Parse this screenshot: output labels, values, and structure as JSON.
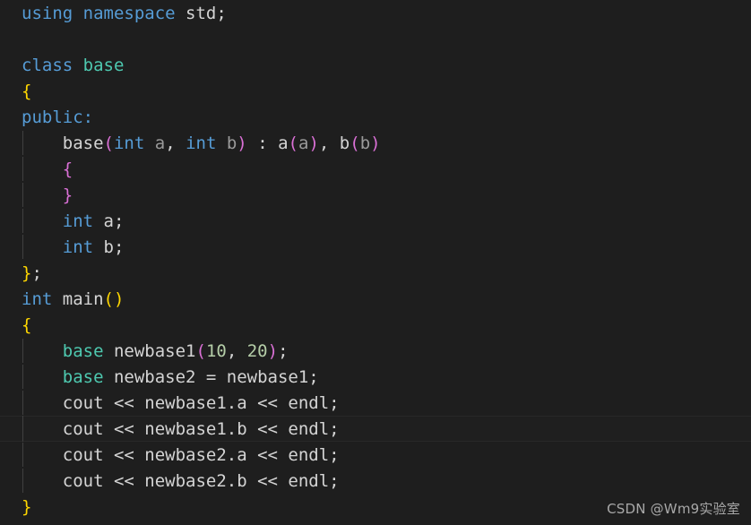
{
  "editor": {
    "language": "cpp",
    "background_color": "#1e1e1e",
    "foreground_color": "#d4d4d4",
    "current_line_index": 17,
    "palette": {
      "keyword": "#569cd6",
      "type": "#4ec9b0",
      "plain": "#d4d4d4",
      "number": "#b5cea8",
      "bracket_level1": "#ffd700",
      "bracket_level2": "#da70d6",
      "parameter": "#9a9a9a",
      "indent_guide": "#404040",
      "current_line_border": "#282828"
    },
    "lines": [
      {
        "indent_guide": false,
        "current": false,
        "tokens": [
          {
            "t": "using namespace ",
            "c": "kw"
          },
          {
            "t": "std;",
            "c": "plain"
          }
        ]
      },
      {
        "indent_guide": false,
        "current": false,
        "tokens": []
      },
      {
        "indent_guide": false,
        "current": false,
        "tokens": [
          {
            "t": "class ",
            "c": "kw"
          },
          {
            "t": "base",
            "c": "type"
          }
        ]
      },
      {
        "indent_guide": false,
        "current": false,
        "tokens": [
          {
            "t": "{",
            "c": "br1"
          }
        ]
      },
      {
        "indent_guide": false,
        "current": false,
        "tokens": [
          {
            "t": "public:",
            "c": "kw"
          }
        ]
      },
      {
        "indent_guide": true,
        "current": false,
        "tokens": [
          {
            "t": "    base",
            "c": "plain"
          },
          {
            "t": "(",
            "c": "br2"
          },
          {
            "t": "int ",
            "c": "kw"
          },
          {
            "t": "a",
            "c": "param"
          },
          {
            "t": ", ",
            "c": "plain"
          },
          {
            "t": "int ",
            "c": "kw"
          },
          {
            "t": "b",
            "c": "param"
          },
          {
            "t": ")",
            "c": "br2"
          },
          {
            "t": " : ",
            "c": "plain"
          },
          {
            "t": "a",
            "c": "plain"
          },
          {
            "t": "(",
            "c": "br2"
          },
          {
            "t": "a",
            "c": "param"
          },
          {
            "t": ")",
            "c": "br2"
          },
          {
            "t": ", ",
            "c": "plain"
          },
          {
            "t": "b",
            "c": "plain"
          },
          {
            "t": "(",
            "c": "br2"
          },
          {
            "t": "b",
            "c": "param"
          },
          {
            "t": ")",
            "c": "br2"
          }
        ]
      },
      {
        "indent_guide": true,
        "current": false,
        "tokens": [
          {
            "t": "    ",
            "c": "plain"
          },
          {
            "t": "{",
            "c": "br2"
          }
        ]
      },
      {
        "indent_guide": true,
        "current": false,
        "tokens": [
          {
            "t": "    ",
            "c": "plain"
          },
          {
            "t": "}",
            "c": "br2"
          }
        ]
      },
      {
        "indent_guide": true,
        "current": false,
        "tokens": [
          {
            "t": "    ",
            "c": "plain"
          },
          {
            "t": "int ",
            "c": "kw"
          },
          {
            "t": "a;",
            "c": "plain"
          }
        ]
      },
      {
        "indent_guide": true,
        "current": false,
        "tokens": [
          {
            "t": "    ",
            "c": "plain"
          },
          {
            "t": "int ",
            "c": "kw"
          },
          {
            "t": "b;",
            "c": "plain"
          }
        ]
      },
      {
        "indent_guide": false,
        "current": false,
        "tokens": [
          {
            "t": "}",
            "c": "br1"
          },
          {
            "t": ";",
            "c": "plain"
          }
        ]
      },
      {
        "indent_guide": false,
        "current": false,
        "tokens": [
          {
            "t": "int ",
            "c": "kw"
          },
          {
            "t": "main",
            "c": "plain"
          },
          {
            "t": "()",
            "c": "br1"
          }
        ]
      },
      {
        "indent_guide": false,
        "current": false,
        "tokens": [
          {
            "t": "{",
            "c": "br1"
          }
        ]
      },
      {
        "indent_guide": true,
        "current": false,
        "tokens": [
          {
            "t": "    ",
            "c": "plain"
          },
          {
            "t": "base",
            "c": "type"
          },
          {
            "t": " newbase1",
            "c": "plain"
          },
          {
            "t": "(",
            "c": "br2"
          },
          {
            "t": "10",
            "c": "num"
          },
          {
            "t": ", ",
            "c": "plain"
          },
          {
            "t": "20",
            "c": "num"
          },
          {
            "t": ")",
            "c": "br2"
          },
          {
            "t": ";",
            "c": "plain"
          }
        ]
      },
      {
        "indent_guide": true,
        "current": false,
        "tokens": [
          {
            "t": "    ",
            "c": "plain"
          },
          {
            "t": "base",
            "c": "type"
          },
          {
            "t": " newbase2 = newbase1;",
            "c": "plain"
          }
        ]
      },
      {
        "indent_guide": true,
        "current": false,
        "tokens": [
          {
            "t": "    cout << newbase1.a << endl;",
            "c": "plain"
          }
        ]
      },
      {
        "indent_guide": true,
        "current": true,
        "tokens": [
          {
            "t": "    cout << newbase1.b << endl;",
            "c": "plain"
          }
        ]
      },
      {
        "indent_guide": true,
        "current": false,
        "tokens": [
          {
            "t": "    cout << newbase2.a << endl;",
            "c": "plain"
          }
        ]
      },
      {
        "indent_guide": true,
        "current": false,
        "tokens": [
          {
            "t": "    cout << newbase2.b << endl;",
            "c": "plain"
          }
        ]
      },
      {
        "indent_guide": false,
        "current": false,
        "tokens": [
          {
            "t": "}",
            "c": "br1"
          }
        ]
      }
    ]
  },
  "watermark": {
    "text": "CSDN @Wm9实验室"
  }
}
